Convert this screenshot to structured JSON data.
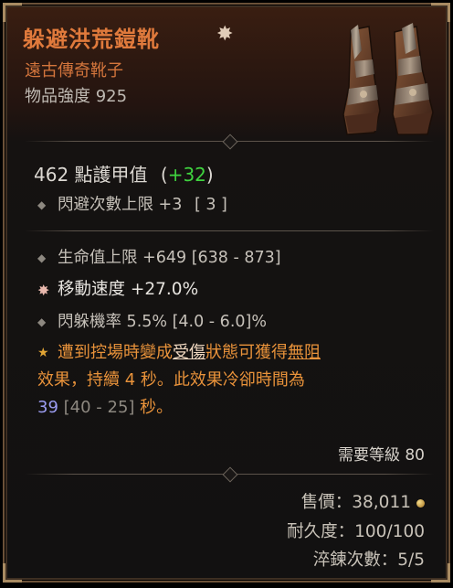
{
  "item": {
    "name": "躲避洪荒鎧靴",
    "type": "遠古傳奇靴子",
    "power": "物品強度 925"
  },
  "armor": {
    "value": "462 點護甲值",
    "open": "(",
    "bonus": "+32",
    "close": ")"
  },
  "implicit": {
    "text": "閃避次數上限 +3",
    "range": "[ 3 ]"
  },
  "affixes": [
    {
      "text": "生命值上限 +649 [638 - 873]",
      "style": "normal"
    },
    {
      "text": "移動速度 +27.0%",
      "style": "greater"
    },
    {
      "text": "閃躲機率 5.5% [4.0 - 6.0]%",
      "style": "normal"
    }
  ],
  "legendary": {
    "part1": "遭到控場時變成",
    "keyword1": "受傷",
    "part2": "狀態可獲得",
    "keyword2": "無阻",
    "line2": "效果，持續 4 秒。此效果冷卻時間為",
    "value": "39",
    "range": "[40 - 25]",
    "end": "秒。"
  },
  "requirement": "需要等級 80",
  "footer": {
    "price_label": "售價：",
    "price_value": "38,011",
    "durability": "耐久度：100/100",
    "temper": "淬鍊次數：5/5"
  },
  "icons": [
    "greater-affix-star-icon",
    "diamond-bullet-icon",
    "legendary-star-icon",
    "gold-coin-icon",
    "boots-item-icon"
  ],
  "colors": {
    "title": "#e07a3c",
    "legendary_text": "#e8923a",
    "bonus_green": "#3fd33f",
    "value_blue": "#9b9cf0"
  }
}
